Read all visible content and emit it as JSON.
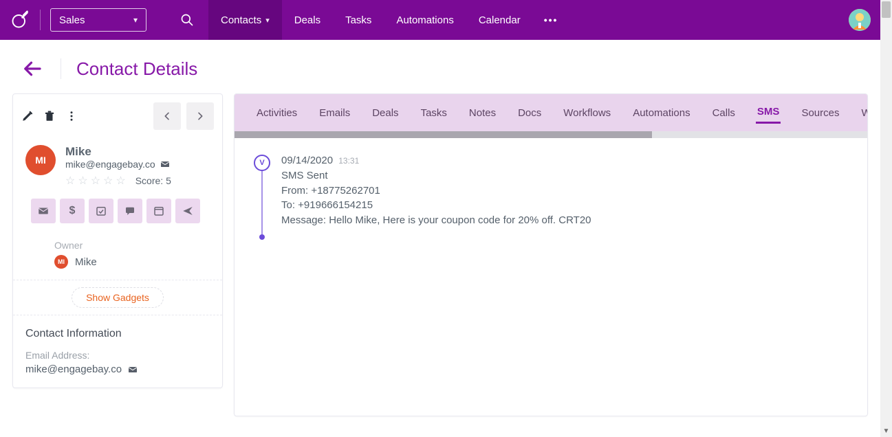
{
  "topbar": {
    "module": "Sales",
    "nav": [
      "Contacts",
      "Deals",
      "Tasks",
      "Automations",
      "Calendar"
    ]
  },
  "page": {
    "title": "Contact Details"
  },
  "contact": {
    "initials": "MI",
    "name": "Mike",
    "email": "mike@engagebay.co",
    "score_label": "Score: 5",
    "owner_label": "Owner",
    "owner": "Mike",
    "owner_initials": "MI",
    "gadgets_label": "Show Gadgets",
    "info_title": "Contact Information",
    "fields": [
      {
        "label": "Email Address:",
        "value": "mike@engagebay.co"
      }
    ]
  },
  "tabs": [
    "Activities",
    "Emails",
    "Deals",
    "Tasks",
    "Notes",
    "Docs",
    "Workflows",
    "Automations",
    "Calls",
    "SMS",
    "Sources",
    "We"
  ],
  "active_tab": "SMS",
  "sms": [
    {
      "badge": "V",
      "date": "09/14/2020",
      "time": "13:31",
      "status": "SMS Sent",
      "from": "From: +18775262701",
      "to": "To: +919666154215",
      "message": "Message: Hello Mike, Here is your coupon code for 20% off. CRT20"
    }
  ]
}
